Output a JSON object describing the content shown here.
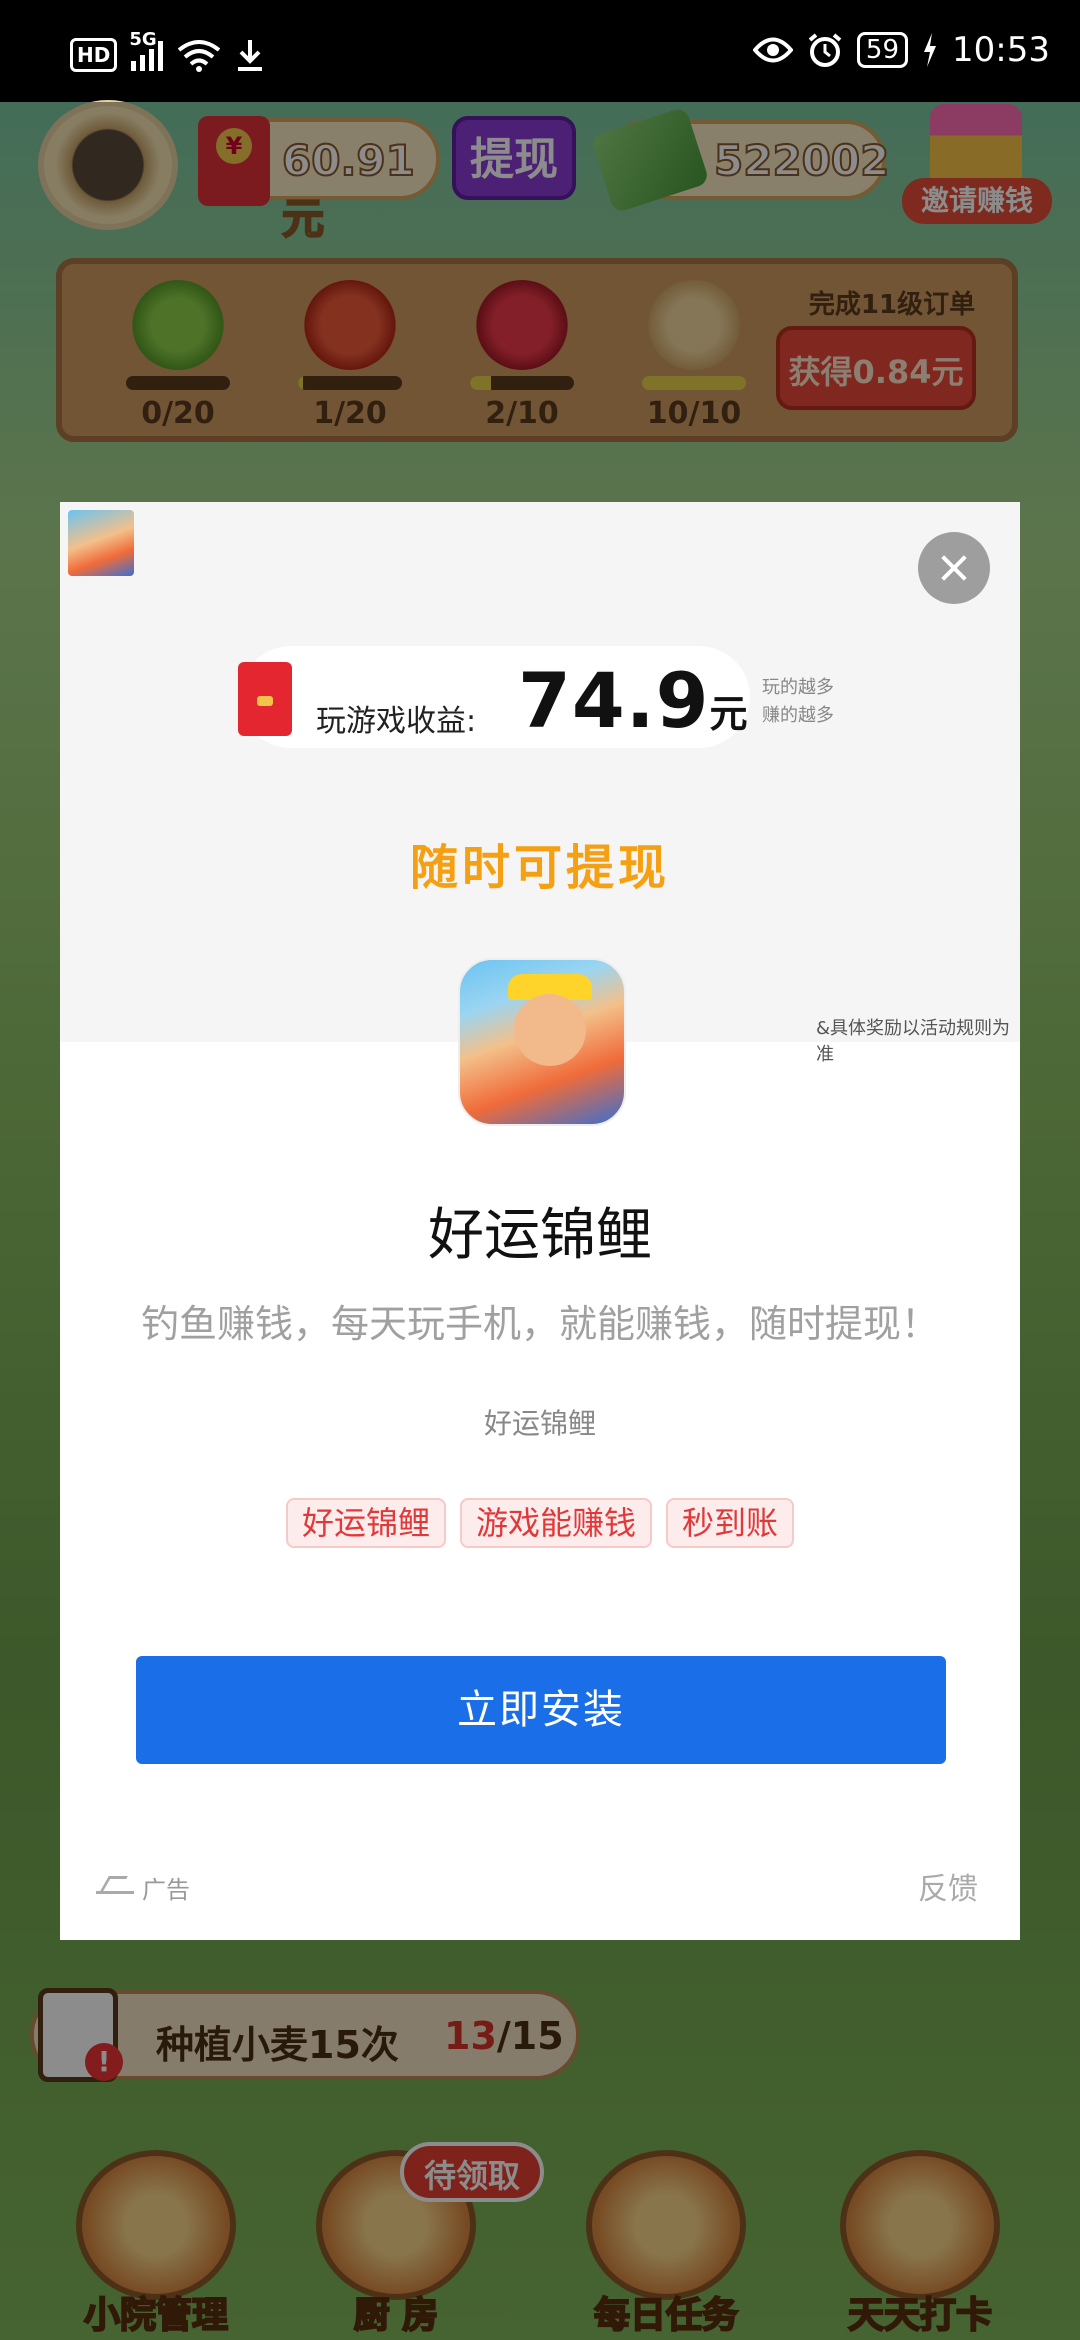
{
  "status_bar": {
    "hd": "HD",
    "network": "5G",
    "battery": "59",
    "time": "10:53"
  },
  "game": {
    "money": "60.91元",
    "withdraw_label": "提现",
    "coins": "522002",
    "invite_label": "邀请赚钱",
    "orders": [
      {
        "name": "beans",
        "count": "0/20",
        "progress": 0
      },
      {
        "name": "tomato",
        "count": "1/20",
        "progress": 0.05
      },
      {
        "name": "strawberry",
        "count": "2/10",
        "progress": 0.2
      },
      {
        "name": "soy-milk",
        "count": "10/10",
        "progress": 1
      }
    ],
    "order_goal": "完成11级订单",
    "claim_label": "获得0.84元",
    "task_text": "种植小麦15次",
    "task_done": "13",
    "task_total": "/15",
    "pending_badge": "待领取",
    "nav": [
      {
        "label": "小院管理"
      },
      {
        "label": "厨 房"
      },
      {
        "label": "每日任务"
      },
      {
        "label": "天天打卡"
      }
    ]
  },
  "ad": {
    "earn_label": "玩游戏收益:",
    "earn_amount": "74.9",
    "earn_unit": "元",
    "earn_note_1": "玩的越多",
    "earn_note_2": "赚的越多",
    "slogan": "随时可提现",
    "rule_note": "&具体奖励以活动规则为准",
    "app_name": "好运锦鲤",
    "app_desc": "钓鱼赚钱，每天玩手机，就能赚钱，随时提现！",
    "app_sub": "好运锦鲤",
    "tags": [
      "好运锦鲤",
      "游戏能赚钱",
      "秒到账"
    ],
    "install_label": "立即安装",
    "ad_label": "广告",
    "feedback_label": "反馈"
  },
  "colors": {
    "install_blue": "#1a6ee8",
    "slogan_orange": "#f5a012",
    "tag_red": "#e0393a"
  }
}
